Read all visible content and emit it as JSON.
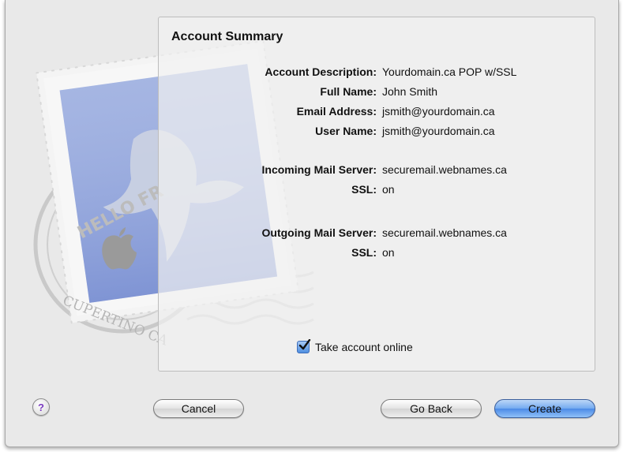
{
  "panel": {
    "title": "Account Summary",
    "rows": [
      {
        "label": "Account Description:",
        "value": "Yourdomain.ca POP w/SSL"
      },
      {
        "label": "Full Name:",
        "value": "John Smith"
      },
      {
        "label": "Email Address:",
        "value": "jsmith@yourdomain.ca"
      },
      {
        "label": "User Name:",
        "value": "jsmith@yourdomain.ca"
      },
      {
        "label": "Incoming Mail Server:",
        "value": "securemail.webnames.ca"
      },
      {
        "label": "SSL:",
        "value": "on"
      },
      {
        "label": "Outgoing Mail Server:",
        "value": "securemail.webnames.ca"
      },
      {
        "label": "SSL:",
        "value": "on"
      }
    ],
    "take_online": {
      "label": "Take account online",
      "checked": true
    }
  },
  "stamp": {
    "text_top": "HELLO FR",
    "text_bottom": "CUPERTINO CA"
  },
  "footer": {
    "help": "?",
    "cancel": "Cancel",
    "go_back": "Go Back",
    "create": "Create"
  },
  "colors": {
    "accent": "#4c8ae6",
    "help_icon": "#7a3bbf"
  }
}
